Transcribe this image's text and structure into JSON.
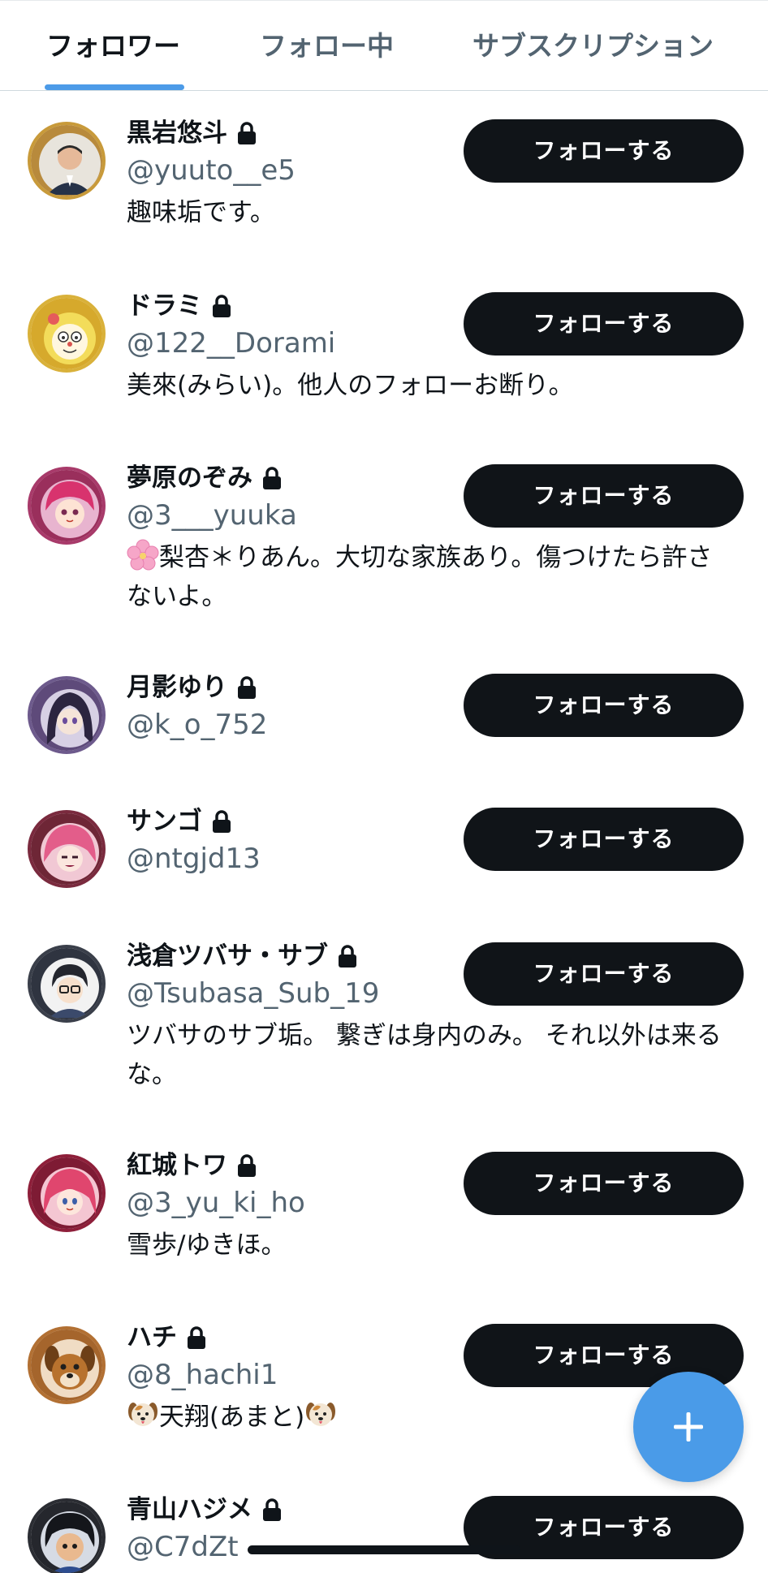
{
  "tabs": [
    {
      "label": "フォロワー",
      "active": true
    },
    {
      "label": "フォロー中",
      "active": false
    },
    {
      "label": "サブスクリプション",
      "active": false
    }
  ],
  "users": [
    {
      "name": "黒岩悠斗",
      "handle": "@yuuto__e5",
      "bio": "趣味垢です。",
      "locked": true,
      "follow_label": "フォローする",
      "avatar_icon": "portrait-man-avatar"
    },
    {
      "name": "ドラミ",
      "handle": "@122__Dorami",
      "bio": "美來(みらい)。他人のフォローお断り。",
      "locked": true,
      "follow_label": "フォローする",
      "avatar_icon": "yellow-robot-avatar"
    },
    {
      "name": "夢原のぞみ",
      "handle": "@3___yuuka",
      "bio_emoji": "cherry-blossom-emoji",
      "bio": "梨杏＊りあん。大切な家族あり。傷つけたら許さないよ。",
      "locked": true,
      "follow_label": "フォローする",
      "avatar_icon": "pink-hair-anime-avatar"
    },
    {
      "name": "月影ゆり",
      "handle": "@k_o_752",
      "bio": "",
      "locked": true,
      "follow_label": "フォローする",
      "avatar_icon": "dark-hair-anime-avatar"
    },
    {
      "name": "サンゴ",
      "handle": "@ntgjd13",
      "bio": "",
      "locked": true,
      "follow_label": "フォローする",
      "avatar_icon": "pink-hair-anime-avatar"
    },
    {
      "name": "浅倉ツバサ・サブ",
      "handle": "@Tsubasa_Sub_19",
      "bio": "ツバサのサブ垢。 繋ぎは身内のみ。 それ以外は来るな。",
      "locked": true,
      "follow_label": "フォローする",
      "avatar_icon": "glasses-boy-avatar"
    },
    {
      "name": "紅城トワ",
      "handle": "@3_yu_ki_ho",
      "bio": "雪歩/ゆきほ。",
      "locked": true,
      "follow_label": "フォローする",
      "avatar_icon": "red-hair-anime-avatar"
    },
    {
      "name": "ハチ",
      "handle": "@8_hachi1",
      "bio_emoji": "dog-face-emoji",
      "bio": "天翔(あまと)",
      "bio_trailing_emoji": "dog-face-emoji",
      "locked": true,
      "follow_label": "フォローする",
      "avatar_icon": "brown-dog-avatar"
    },
    {
      "name": "青山ハジメ",
      "handle": "@C7dZt",
      "bio": "",
      "locked": true,
      "follow_label": "フォローする",
      "avatar_icon": "dark-hair-boy-avatar"
    }
  ],
  "fab": {
    "icon": "plus-icon"
  },
  "colors": {
    "accent": "#4c9be8",
    "button_bg": "#101418",
    "text_primary": "#0f1419",
    "text_secondary": "#536471"
  }
}
